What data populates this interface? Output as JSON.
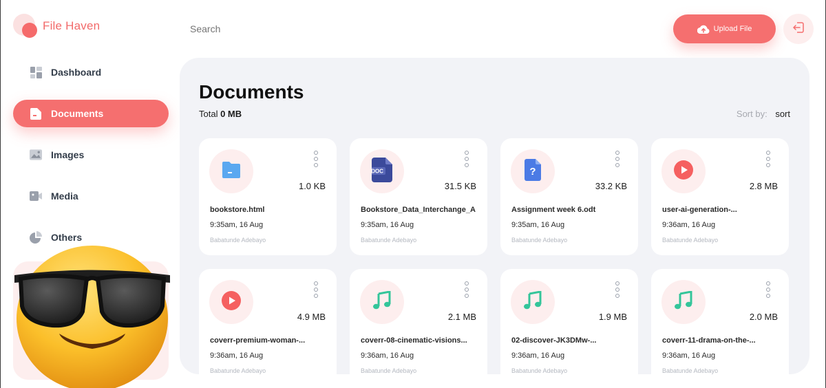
{
  "app": {
    "name": "File Haven"
  },
  "sidebar": {
    "items": [
      {
        "label": "Dashboard",
        "icon": "dashboard-icon",
        "active": false
      },
      {
        "label": "Documents",
        "icon": "document-icon",
        "active": true
      },
      {
        "label": "Images",
        "icon": "image-icon",
        "active": false
      },
      {
        "label": "Media",
        "icon": "video-icon",
        "active": false
      },
      {
        "label": "Others",
        "icon": "pie-chart-icon",
        "active": false
      }
    ]
  },
  "header": {
    "search_placeholder": "Search",
    "upload_label": "Upload File",
    "logout_icon": "logout-icon"
  },
  "main": {
    "title": "Documents",
    "total_label": "Total",
    "total_value": "0 MB",
    "sort_label": "Sort by:",
    "sort_value": "sort",
    "files": [
      {
        "name": "bookstore.html",
        "size": "1.0 KB",
        "time": "9:35am, 16 Aug",
        "owner": "Babatunde Adebayo",
        "icon": "folder-file-icon"
      },
      {
        "name": "Bookstore_Data_Interchange_A",
        "size": "31.5 KB",
        "time": "9:35am, 16 Aug",
        "owner": "Babatunde Adebayo",
        "icon": "doc-file-icon"
      },
      {
        "name": "Assignment week 6.odt",
        "size": "33.2 KB",
        "time": "9:35am, 16 Aug",
        "owner": "Babatunde Adebayo",
        "icon": "unknown-file-icon"
      },
      {
        "name": "user-ai-generation-...",
        "size": "2.8 MB",
        "time": "9:36am, 16 Aug",
        "owner": "Babatunde Adebayo",
        "icon": "play-icon"
      },
      {
        "name": "coverr-premium-woman-...",
        "size": "4.9 MB",
        "time": "9:36am, 16 Aug",
        "owner": "Babatunde Adebayo",
        "icon": "play-icon"
      },
      {
        "name": "coverr-08-cinematic-visions...",
        "size": "2.1 MB",
        "time": "9:36am, 16 Aug",
        "owner": "Babatunde Adebayo",
        "icon": "music-note-icon"
      },
      {
        "name": "02-discover-JK3DMw-...",
        "size": "1.9 MB",
        "time": "9:36am, 16 Aug",
        "owner": "Babatunde Adebayo",
        "icon": "music-note-icon"
      },
      {
        "name": "coverr-11-drama-on-the-...",
        "size": "2.0 MB",
        "time": "9:36am, 16 Aug",
        "owner": "Babatunde Adebayo",
        "icon": "music-note-icon"
      }
    ]
  },
  "colors": {
    "accent": "#f56f6f",
    "accent_light": "#fdeeee",
    "panel_bg": "#f2f3f7",
    "music": "#34c59a",
    "doc": "#3b4a9b",
    "folder": "#5aa8f0"
  }
}
